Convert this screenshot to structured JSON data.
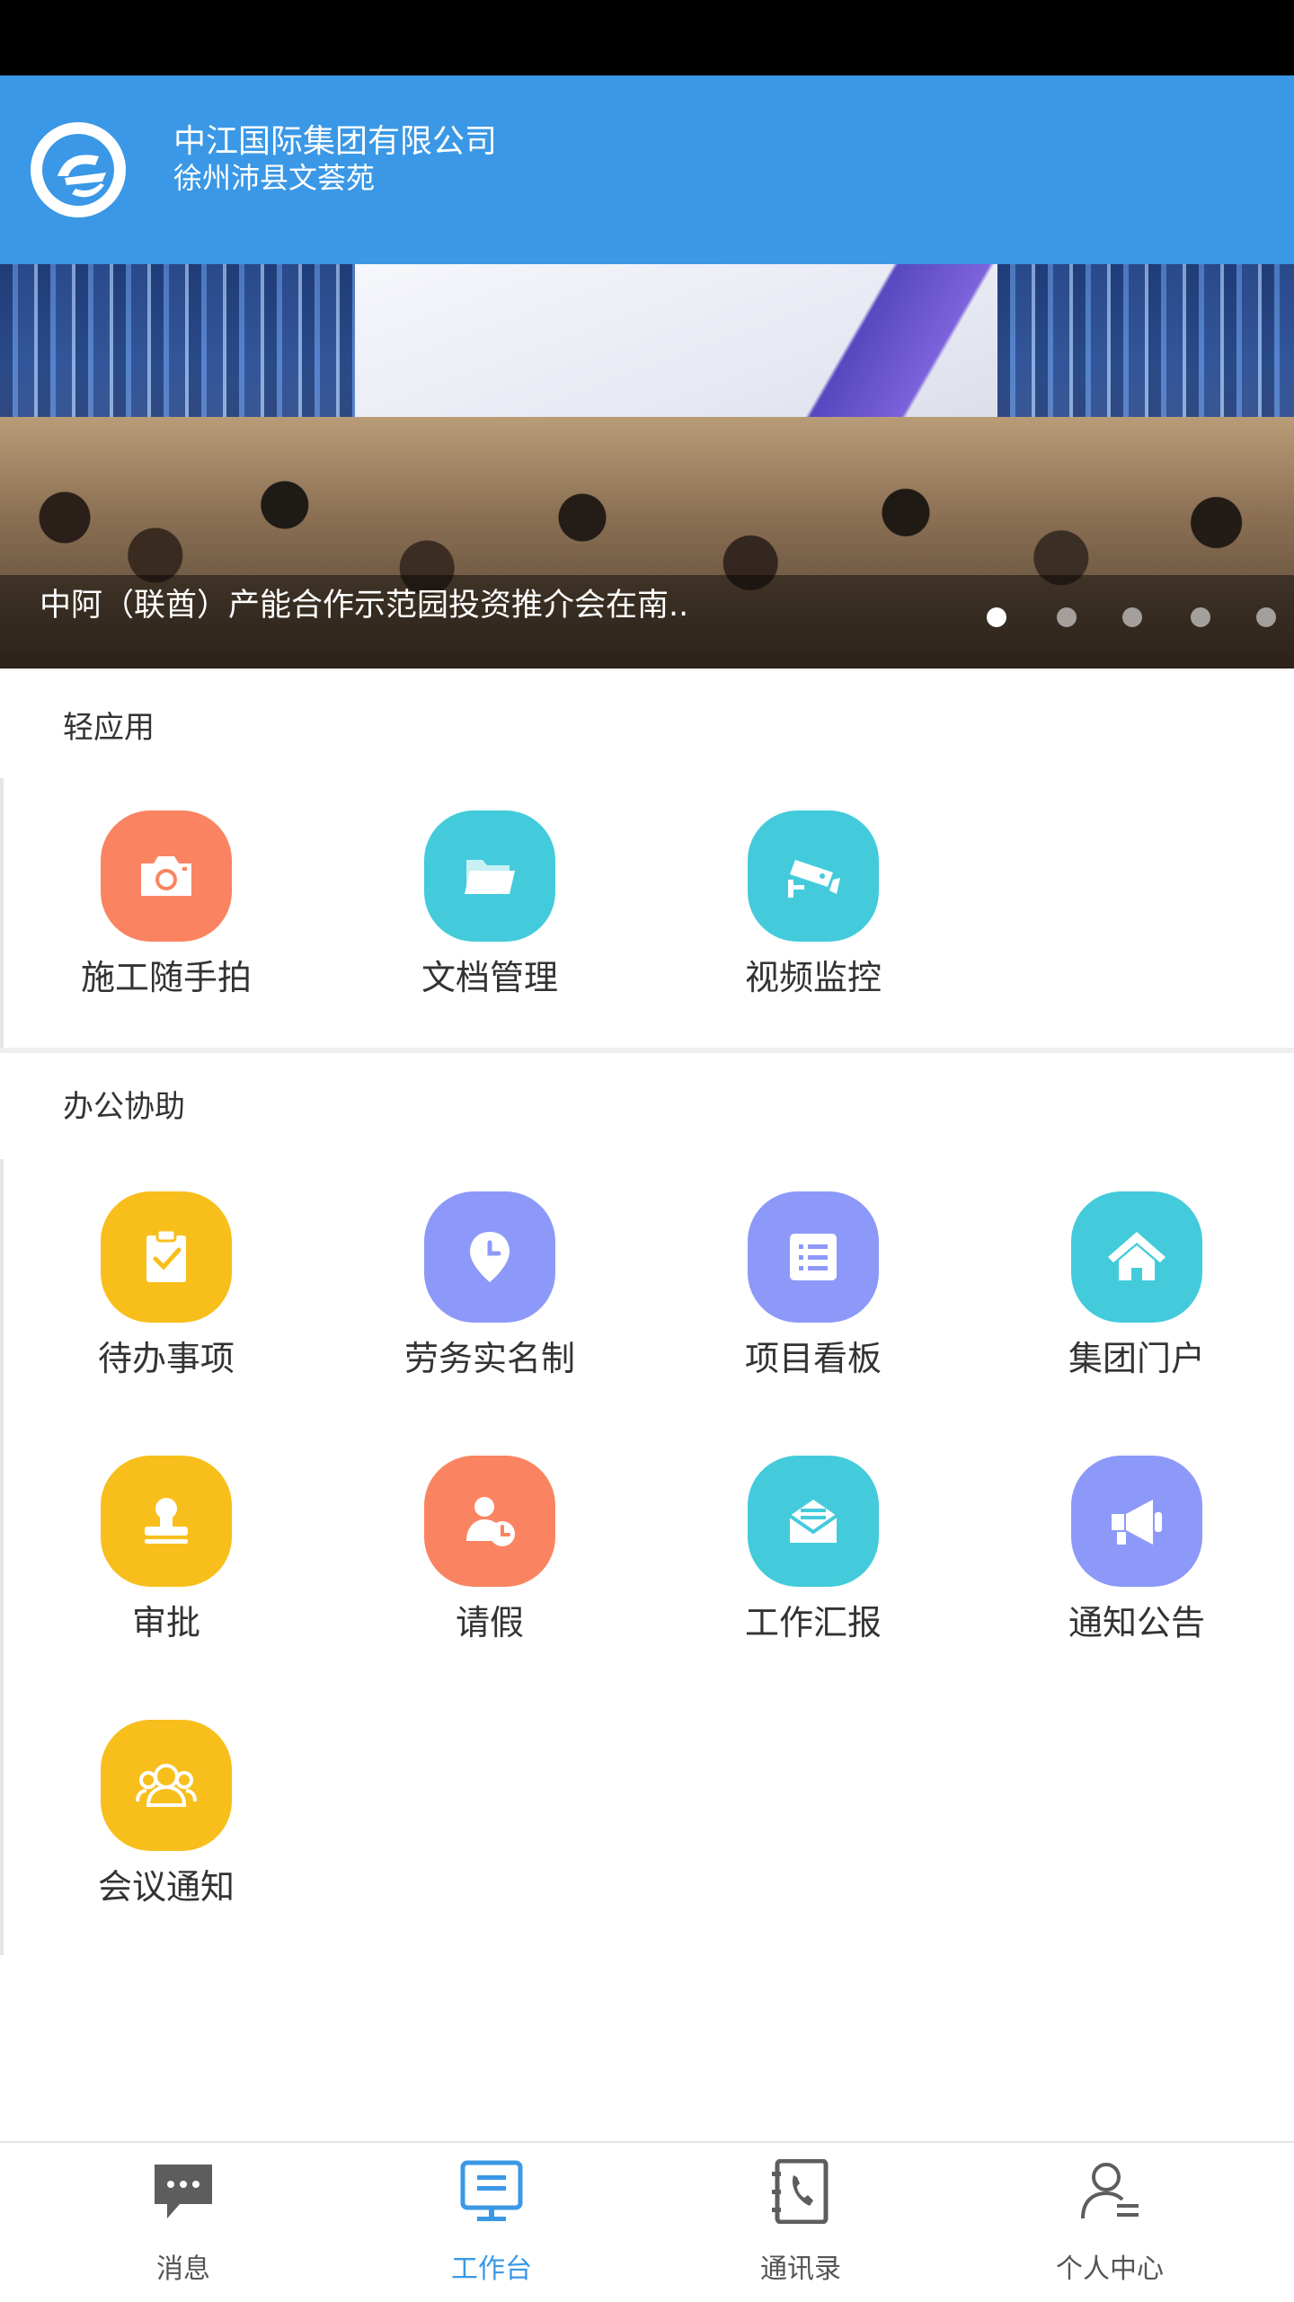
{
  "header": {
    "company": "中江国际集团有限公司",
    "site": "徐州沛县文荟苑",
    "logo_icon": "company-logo-icon"
  },
  "banner": {
    "caption": "中阿（联酋）产能合作示范园投资推介会在南..",
    "slide_count": 5,
    "active_slide": 1
  },
  "light_apps": {
    "title": "轻应用",
    "items": [
      {
        "label": "施工随手拍",
        "icon": "camera-icon",
        "color": "#fa8461"
      },
      {
        "label": "文档管理",
        "icon": "folder-icon",
        "color": "#43cbdc"
      },
      {
        "label": "视频监控",
        "icon": "cctv-camera-icon",
        "color": "#43cbdc"
      }
    ]
  },
  "office": {
    "title": "办公协助",
    "items": [
      {
        "label": "待办事项",
        "icon": "clipboard-check-icon",
        "color": "#f8be1b"
      },
      {
        "label": "劳务实名制",
        "icon": "location-clock-icon",
        "color": "#8d99f9"
      },
      {
        "label": "项目看板",
        "icon": "list-board-icon",
        "color": "#8d99f9"
      },
      {
        "label": "集团门户",
        "icon": "home-icon",
        "color": "#43cbdc"
      },
      {
        "label": "审批",
        "icon": "stamp-icon",
        "color": "#f8be1b"
      },
      {
        "label": "请假",
        "icon": "person-clock-icon",
        "color": "#fa8461"
      },
      {
        "label": "工作汇报",
        "icon": "mail-report-icon",
        "color": "#43cbdc"
      },
      {
        "label": "通知公告",
        "icon": "megaphone-icon",
        "color": "#8d99f9"
      },
      {
        "label": "会议通知",
        "icon": "people-group-icon",
        "color": "#f8be1b"
      }
    ]
  },
  "nav": {
    "items": [
      {
        "label": "消息",
        "icon": "chat-bubble-icon"
      },
      {
        "label": "工作台",
        "icon": "desk-monitor-icon"
      },
      {
        "label": "通讯录",
        "icon": "phonebook-icon"
      },
      {
        "label": "个人中心",
        "icon": "user-profile-icon"
      }
    ],
    "active": "工作台",
    "active_color": "#3a98e6"
  }
}
